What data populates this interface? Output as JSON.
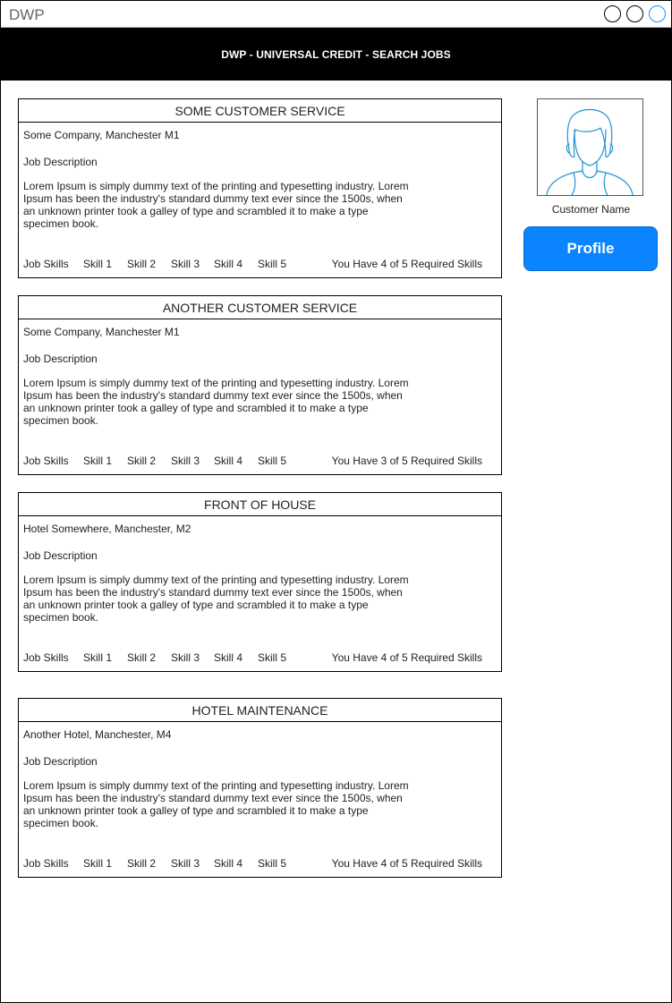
{
  "app": {
    "title": "DWP"
  },
  "header": {
    "title": "DWP  - UNIVERSAL CREDIT - SEARCH JOBS"
  },
  "profile": {
    "customer_name": "Customer Name",
    "button_label": "Profile"
  },
  "colors": {
    "header_bg": "#000000",
    "profile_button": "#0a85ff",
    "avatar_stroke": "#1f94d3"
  },
  "jobs": [
    {
      "title": "SOME CUSTOMER SERVICE",
      "company": "Some Company, Manchester M1",
      "description_label": "Job Description",
      "description": "Lorem Ipsum is simply dummy text of the printing and typesetting industry. Lorem Ipsum has been the industry's standard dummy text ever since the 1500s, when an unknown printer took a galley of type and scrambled it to make a type specimen book.",
      "skills_label": "Job Skills",
      "skills": [
        "Skill 1",
        "Skill 2",
        "Skill 3",
        "Skill 4",
        "Skill 5"
      ],
      "requirement": "You Have 4 of 5 Required Skills"
    },
    {
      "title": "ANOTHER CUSTOMER SERVICE",
      "company": "Some Company, Manchester M1",
      "description_label": "Job Description",
      "description": "Lorem Ipsum is simply dummy text of the printing and typesetting industry. Lorem Ipsum has been the industry's standard dummy text ever since the 1500s, when an unknown printer took a galley of type and scrambled it to make a type specimen book.",
      "skills_label": "Job Skills",
      "skills": [
        "Skill 1",
        "Skill 2",
        "Skill 3",
        "Skill 4",
        "Skill 5"
      ],
      "requirement": "You Have 3 of 5 Required Skills"
    },
    {
      "title": "FRONT OF HOUSE",
      "company": "Hotel Somewhere, Manchester, M2",
      "description_label": "Job Description",
      "description": "Lorem Ipsum is simply dummy text of the printing and typesetting industry. Lorem Ipsum has been the industry's standard dummy text ever since the 1500s, when an unknown printer took a galley of type and scrambled it to make a type specimen book.",
      "skills_label": "Job Skills",
      "skills": [
        "Skill 1",
        "Skill 2",
        "Skill 3",
        "Skill 4",
        "Skill 5"
      ],
      "requirement": "You Have 4 of 5 Required Skills"
    },
    {
      "title": "HOTEL MAINTENANCE",
      "company": "Another Hotel, Manchester, M4",
      "description_label": "Job Description",
      "description": "Lorem Ipsum is simply dummy text of the printing and typesetting industry. Lorem Ipsum has been the industry's standard dummy text ever since the 1500s, when an unknown printer took a galley of type and scrambled it to make a type specimen book.",
      "skills_label": "Job Skills",
      "skills": [
        "Skill 1",
        "Skill 2",
        "Skill 3",
        "Skill 4",
        "Skill 5"
      ],
      "requirement": "You Have 4 of 5 Required Skills"
    }
  ]
}
